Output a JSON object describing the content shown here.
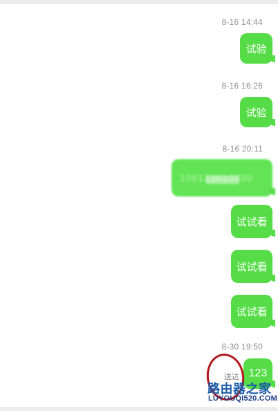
{
  "conversation": {
    "messages": [
      {
        "time": "8-16 14:44",
        "text": "试验"
      },
      {
        "time": "8-16 16:26",
        "text": "试验"
      },
      {
        "time": "8-16 20:11",
        "text": "106123010030",
        "blurred": true
      },
      {
        "text": "试试看"
      },
      {
        "text": "试试看"
      },
      {
        "text": "试试看"
      },
      {
        "time": "8-30 19:50",
        "text": "123",
        "status": "送达"
      }
    ]
  },
  "watermark": {
    "cn": "路由器之家",
    "en": "LUYOUQI520.COM"
  },
  "colors": {
    "bubble": "#55dc46",
    "timestamp": "#8f8f8f",
    "circle": "#b0161b",
    "watermark": "#1b5aa8"
  }
}
